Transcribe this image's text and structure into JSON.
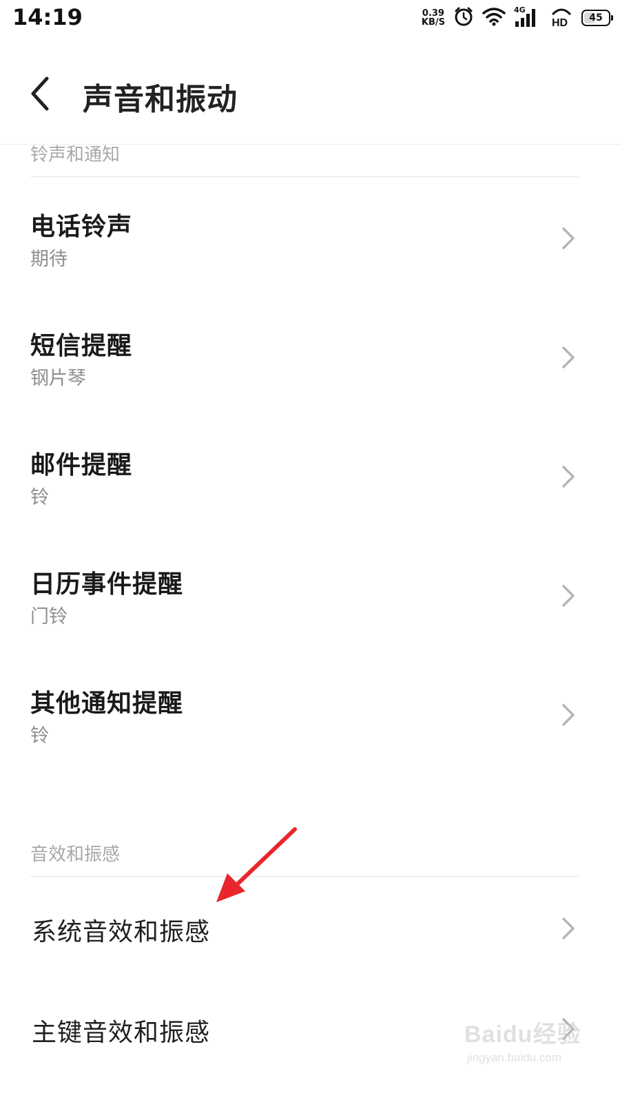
{
  "status_bar": {
    "time": "14:19",
    "net_speed_value": "0.39",
    "net_speed_unit": "KB/S",
    "network_type": "4G",
    "hd_label": "HD",
    "battery_level": "45",
    "icons": [
      "alarm-icon",
      "wifi-icon",
      "signal-icon",
      "hd-icon",
      "battery-icon"
    ]
  },
  "header": {
    "title": "声音和振动",
    "back_icon": "chevron-left-icon"
  },
  "ringtones_section": {
    "header": "铃声和通知",
    "items": [
      {
        "title": "电话铃声",
        "subtitle": "期待"
      },
      {
        "title": "短信提醒",
        "subtitle": "钢片琴"
      },
      {
        "title": "邮件提醒",
        "subtitle": "铃"
      },
      {
        "title": "日历事件提醒",
        "subtitle": "门铃"
      },
      {
        "title": "其他通知提醒",
        "subtitle": "铃"
      }
    ]
  },
  "effects_section": {
    "header": "音效和振感",
    "items": [
      {
        "title": "系统音效和振感"
      },
      {
        "title": "主键音效和振感"
      }
    ]
  },
  "watermark": {
    "brand": "Baidu经验",
    "url": "jingyan.baidu.com"
  },
  "colors": {
    "accent_arrow": "#e8262b",
    "section_header": "#a8a8a8",
    "subtitle": "#8e8e8e",
    "chevron": "#b5b5b5"
  }
}
